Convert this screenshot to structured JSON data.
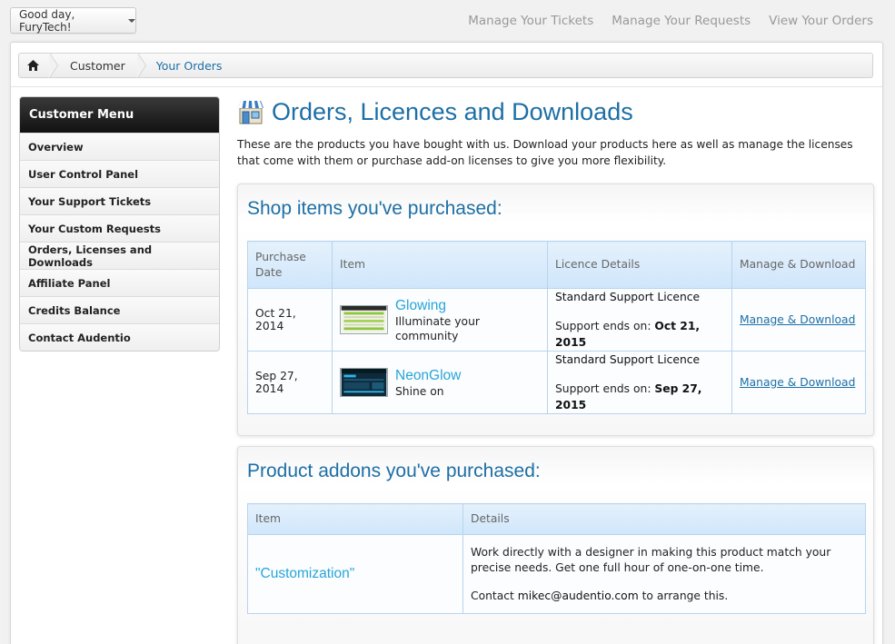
{
  "topbar": {
    "greeting": "Good day, FuryTech!",
    "nav": [
      "Manage Your Tickets",
      "Manage Your Requests",
      "View Your Orders"
    ]
  },
  "breadcrumb": {
    "items": [
      "Customer",
      "Your Orders"
    ]
  },
  "sidebar": {
    "title": "Customer Menu",
    "items": [
      {
        "label": "Overview"
      },
      {
        "label": "User Control Panel"
      },
      {
        "label": "Your Support Tickets"
      },
      {
        "label": "Your Custom Requests"
      },
      {
        "label": "Orders, Licenses and Downloads"
      },
      {
        "label": "Affiliate Panel"
      },
      {
        "label": "Credits Balance"
      },
      {
        "label": "Contact Audentio"
      }
    ]
  },
  "main": {
    "title": "Orders, Licences and Downloads",
    "intro": "These are the products you have bought with us. Download your products here as well as manage the licenses that come with them or purchase add-on licenses to give you more flexibility."
  },
  "purchases": {
    "heading": "Shop items you've purchased:",
    "columns": [
      "Purchase Date",
      "Item",
      "Licence Details",
      "Manage & Download"
    ],
    "rows": [
      {
        "date": "Oct 21, 2014",
        "name": "Glowing",
        "desc": "Illuminate your community",
        "licence": "Standard Support Licence",
        "support_label": "Support ends on:",
        "support_date": "Oct 21, 2015",
        "action": "Manage & Download"
      },
      {
        "date": "Sep 27, 2014",
        "name": "NeonGlow",
        "desc": "Shine on",
        "licence": "Standard Support Licence",
        "support_label": "Support ends on:",
        "support_date": "Sep 27, 2015",
        "action": "Manage & Download"
      }
    ]
  },
  "addons": {
    "heading": "Product addons you've purchased:",
    "columns": [
      "Item",
      "Details"
    ],
    "rows": [
      {
        "name": "\"Customization\"",
        "details": "Work directly with a designer in making this product match your precise needs. Get one full hour of one-on-one time.",
        "contact_prefix": "Contact",
        "contact_email": "mikec@audentio.com",
        "contact_suffix": "to arrange this."
      }
    ]
  },
  "colors": {
    "accent": "#1d6fa5",
    "item_link": "#27a5d8",
    "table_header": "#d6e9fb"
  }
}
